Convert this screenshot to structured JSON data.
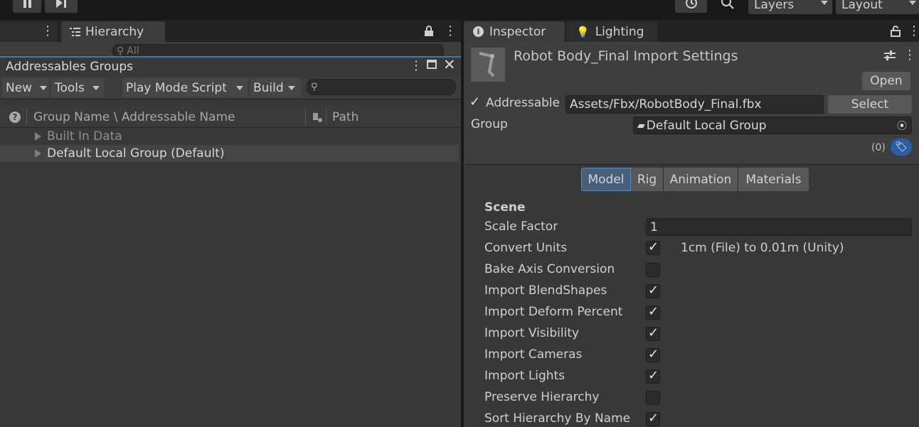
{
  "toolbar": {
    "layers_label": "Layers",
    "layout_label": "Layout"
  },
  "hierarchy": {
    "tab_label": "Hierarchy",
    "search_placeholder": "All"
  },
  "addressables": {
    "title": "Addressables Groups",
    "buttons": {
      "new": "New",
      "tools": "Tools",
      "play_mode": "Play Mode Script",
      "build": "Build"
    },
    "columns": {
      "name": "Group Name \\ Addressable Name",
      "path": "Path"
    },
    "rows": [
      {
        "label": "Built In Data"
      },
      {
        "label": "Default Local Group (Default)"
      }
    ]
  },
  "inspector": {
    "tabs": {
      "inspector": "Inspector",
      "lighting": "Lighting"
    },
    "title": "Robot Body_Final Import Settings",
    "open_label": "Open",
    "addressable_label": "Addressable",
    "addressable_path": "Assets/Fbx/RobotBody_Final.fbx",
    "select_label": "Select",
    "group_label": "Group",
    "group_value": "Default Local Group",
    "labels_count": "(0)",
    "segments": [
      "Model",
      "Rig",
      "Animation",
      "Materials"
    ],
    "section": "Scene",
    "scale_factor_label": "Scale Factor",
    "scale_factor_value": "1",
    "convert_units_label": "Convert Units",
    "convert_units_note": "1cm (File) to 0.01m (Unity)",
    "settings": [
      {
        "label": "Bake Axis Conversion",
        "checked": false
      },
      {
        "label": "Import BlendShapes",
        "checked": true
      },
      {
        "label": "Import Deform Percent",
        "checked": true
      },
      {
        "label": "Import Visibility",
        "checked": true
      },
      {
        "label": "Import Cameras",
        "checked": true
      },
      {
        "label": "Import Lights",
        "checked": true
      },
      {
        "label": "Preserve Hierarchy",
        "checked": false
      },
      {
        "label": "Sort Hierarchy By Name",
        "checked": true
      }
    ]
  },
  "colors": {
    "accent": "#3a79bb",
    "panel": "#383838",
    "selected_tab": "#46607c"
  }
}
